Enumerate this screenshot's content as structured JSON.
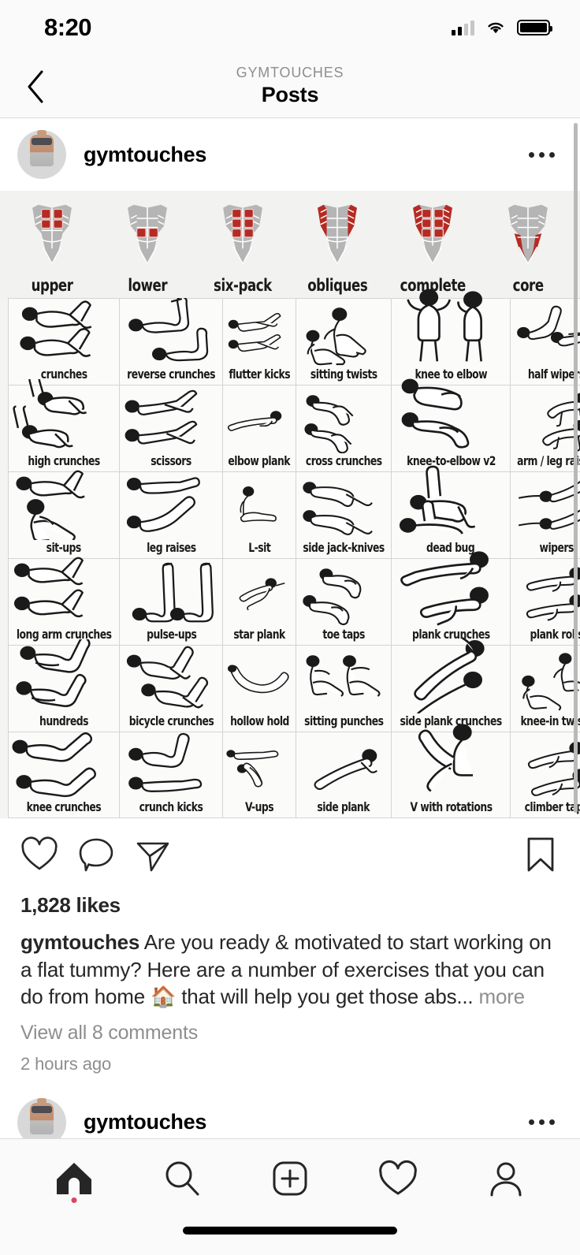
{
  "status_bar": {
    "time": "8:20",
    "cellular_icon": "signal-bars-icon",
    "wifi_icon": "wifi-icon",
    "battery_icon": "battery-full-icon"
  },
  "nav_bar": {
    "back_icon": "chevron-left-icon",
    "kicker": "GYMTOUCHES",
    "title": "Posts"
  },
  "post": {
    "avatar_name": "gymtouches-avatar",
    "username": "gymtouches",
    "more_icon": "more-options-icon",
    "likes": "1,828 likes",
    "caption_author": "gymtouches",
    "caption_text": "Are you ready & motivated to start working on a flat tummy? Here are a number of exercises that you can do from home 🏠 that will help you get those abs...",
    "caption_more": "more",
    "comments_link": "View all 8 comments",
    "timestamp": "2 hours ago",
    "actions": {
      "like": "heart-icon",
      "comment": "comment-bubble-icon",
      "share": "share-paper-plane-icon",
      "save": "bookmark-icon"
    }
  },
  "infographic": {
    "abs_types": [
      {
        "label": "upper",
        "highlight": "upper"
      },
      {
        "label": "lower",
        "highlight": "lower"
      },
      {
        "label": "six-pack",
        "highlight": "sixpack"
      },
      {
        "label": "obliques",
        "highlight": "obliques"
      },
      {
        "label": "complete",
        "highlight": "complete"
      },
      {
        "label": "core",
        "highlight": "core"
      }
    ],
    "highlight_color": "#b52b23",
    "muscle_color": "#b5b5b5",
    "exercises": [
      {
        "label": "crunches",
        "pose": "lying-knee-crunch"
      },
      {
        "label": "reverse crunches",
        "pose": "reverse-crunch"
      },
      {
        "label": "flutter kicks",
        "pose": "flutter-kick"
      },
      {
        "label": "sitting twists",
        "pose": "seated-twist"
      },
      {
        "label": "knee to elbow",
        "pose": "standing-knee-elbow"
      },
      {
        "label": "half wipers",
        "pose": "half-wiper"
      },
      {
        "label": "high crunches",
        "pose": "high-crunch"
      },
      {
        "label": "scissors",
        "pose": "scissor"
      },
      {
        "label": "elbow plank",
        "pose": "elbow-plank"
      },
      {
        "label": "cross crunches",
        "pose": "cross-crunch"
      },
      {
        "label": "knee-to-elbow v2",
        "pose": "knee-elbow-v2"
      },
      {
        "label": "arm / leg raises",
        "pose": "bird-dog"
      },
      {
        "label": "sit-ups",
        "pose": "sit-up"
      },
      {
        "label": "leg raises",
        "pose": "leg-raise"
      },
      {
        "label": "L-sit",
        "pose": "l-sit"
      },
      {
        "label": "side jack-knives",
        "pose": "side-jackknife"
      },
      {
        "label": "dead bug",
        "pose": "dead-bug"
      },
      {
        "label": "wipers",
        "pose": "wiper"
      },
      {
        "label": "long arm crunches",
        "pose": "long-arm-crunch"
      },
      {
        "label": "pulse-ups",
        "pose": "pulse-up"
      },
      {
        "label": "star plank",
        "pose": "star-plank"
      },
      {
        "label": "toe taps",
        "pose": "toe-tap"
      },
      {
        "label": "plank crunches",
        "pose": "plank-crunch"
      },
      {
        "label": "plank rolls",
        "pose": "plank-roll"
      },
      {
        "label": "hundreds",
        "pose": "hundred"
      },
      {
        "label": "bicycle crunches",
        "pose": "bicycle-crunch"
      },
      {
        "label": "hollow hold",
        "pose": "hollow-hold"
      },
      {
        "label": "sitting punches",
        "pose": "sitting-punch"
      },
      {
        "label": "side plank crunches",
        "pose": "side-plank-crunch"
      },
      {
        "label": "knee-in twists",
        "pose": "knee-in-twist"
      },
      {
        "label": "knee crunches",
        "pose": "knee-crunch"
      },
      {
        "label": "crunch kicks",
        "pose": "crunch-kick"
      },
      {
        "label": "V-ups",
        "pose": "v-up"
      },
      {
        "label": "side plank",
        "pose": "side-plank"
      },
      {
        "label": "V with rotations",
        "pose": "v-rotation"
      },
      {
        "label": "climber taps",
        "pose": "climber-tap"
      }
    ]
  },
  "tab_bar": {
    "items": [
      {
        "name": "home-tab",
        "icon": "home-icon",
        "active": true
      },
      {
        "name": "search-tab",
        "icon": "search-icon",
        "active": false
      },
      {
        "name": "create-tab",
        "icon": "plus-box-icon",
        "active": false
      },
      {
        "name": "activity-tab",
        "icon": "heart-icon",
        "active": false
      },
      {
        "name": "profile-tab",
        "icon": "person-icon",
        "active": false
      }
    ]
  }
}
